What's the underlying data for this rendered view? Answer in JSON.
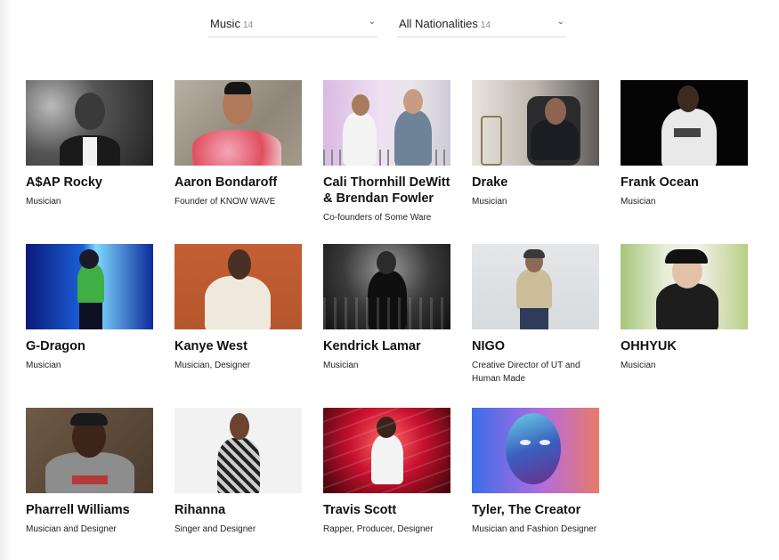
{
  "filters": [
    {
      "label": "Music",
      "count": "14"
    },
    {
      "label": "All Nationalities",
      "count": "14"
    }
  ],
  "people": [
    {
      "name": "A$AP Rocky",
      "role": "Musician"
    },
    {
      "name": "Aaron Bondaroff",
      "role": "Founder of KNOW WAVE"
    },
    {
      "name": "Cali Thornhill DeWitt & Brendan Fowler",
      "role": "Co-founders of Some Ware"
    },
    {
      "name": "Drake",
      "role": "Musician"
    },
    {
      "name": "Frank Ocean",
      "role": "Musician"
    },
    {
      "name": "G-Dragon",
      "role": "Musician"
    },
    {
      "name": "Kanye West",
      "role": "Musician, Designer"
    },
    {
      "name": "Kendrick Lamar",
      "role": "Musician"
    },
    {
      "name": "NIGO",
      "role": "Creative Director of UT and Human Made"
    },
    {
      "name": "OHHYUK",
      "role": "Musician"
    },
    {
      "name": "Pharrell Williams",
      "role": "Musician and Designer"
    },
    {
      "name": "Rihanna",
      "role": "Singer and Designer"
    },
    {
      "name": "Travis Scott",
      "role": "Rapper, Producer, Designer"
    },
    {
      "name": "Tyler, The Creator",
      "role": "Musician and Fashion Designer"
    }
  ]
}
